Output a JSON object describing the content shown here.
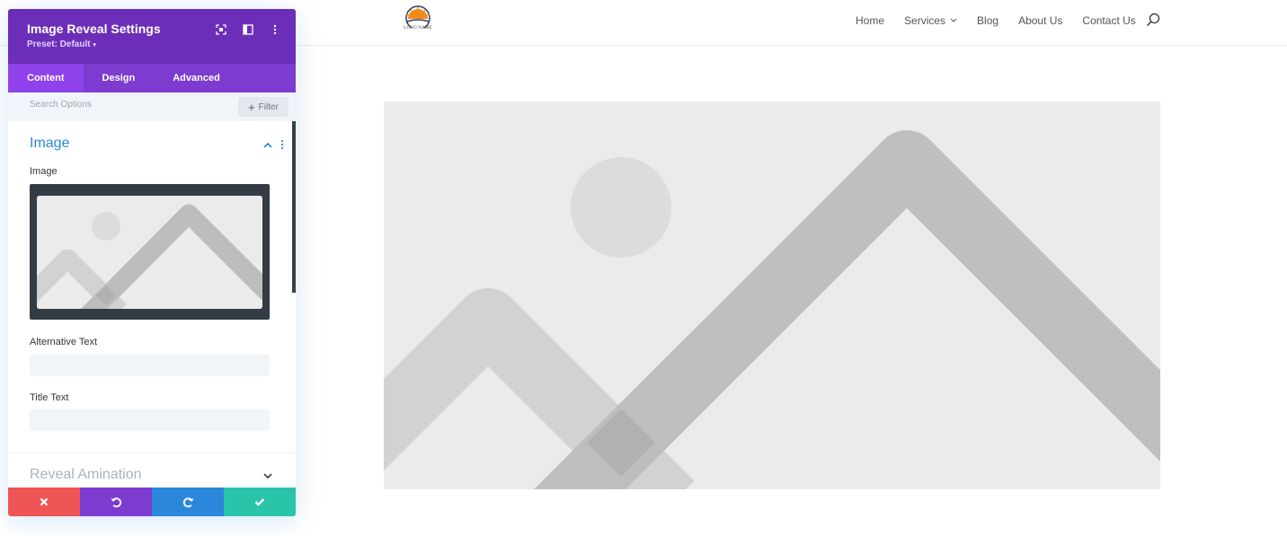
{
  "site": {
    "logo_text": "LOGO NAME",
    "nav": [
      {
        "label": "Home",
        "has_dropdown": false
      },
      {
        "label": "Services",
        "has_dropdown": true
      },
      {
        "label": "Blog",
        "has_dropdown": false
      },
      {
        "label": "About Us",
        "has_dropdown": false
      },
      {
        "label": "Contact Us",
        "has_dropdown": false
      }
    ],
    "search_icon": "search-icon"
  },
  "panel": {
    "title": "Image Reveal Settings",
    "preset": "Preset: Default",
    "header_icons": [
      "expand-icon",
      "sidebar-toggle-icon",
      "more-vertical-icon"
    ],
    "tabs": [
      {
        "label": "Content",
        "active": true
      },
      {
        "label": "Design",
        "active": false
      },
      {
        "label": "Advanced",
        "active": false
      }
    ],
    "search": {
      "placeholder": "Search Options",
      "filter_label": "Filter"
    },
    "sections": {
      "image": {
        "title": "Image",
        "expanded": true,
        "image_label": "Image",
        "alt_label": "Alternative Text",
        "alt_value": "",
        "title_label": "Title Text",
        "title_value": ""
      },
      "reveal": {
        "title": "Reveal Amination",
        "expanded": false
      }
    },
    "bottom_bar": [
      "close-icon",
      "undo-icon",
      "redo-icon",
      "check-icon"
    ]
  },
  "colors": {
    "panel_header": "#6c2eb9",
    "tabs_bg": "#7d3bcf",
    "tab_active": "#8f42ec",
    "accent_blue": "#2b87da",
    "cancel": "#ef5555",
    "undo": "#7e3bd0",
    "redo": "#2b87da",
    "save": "#29c4a9"
  }
}
